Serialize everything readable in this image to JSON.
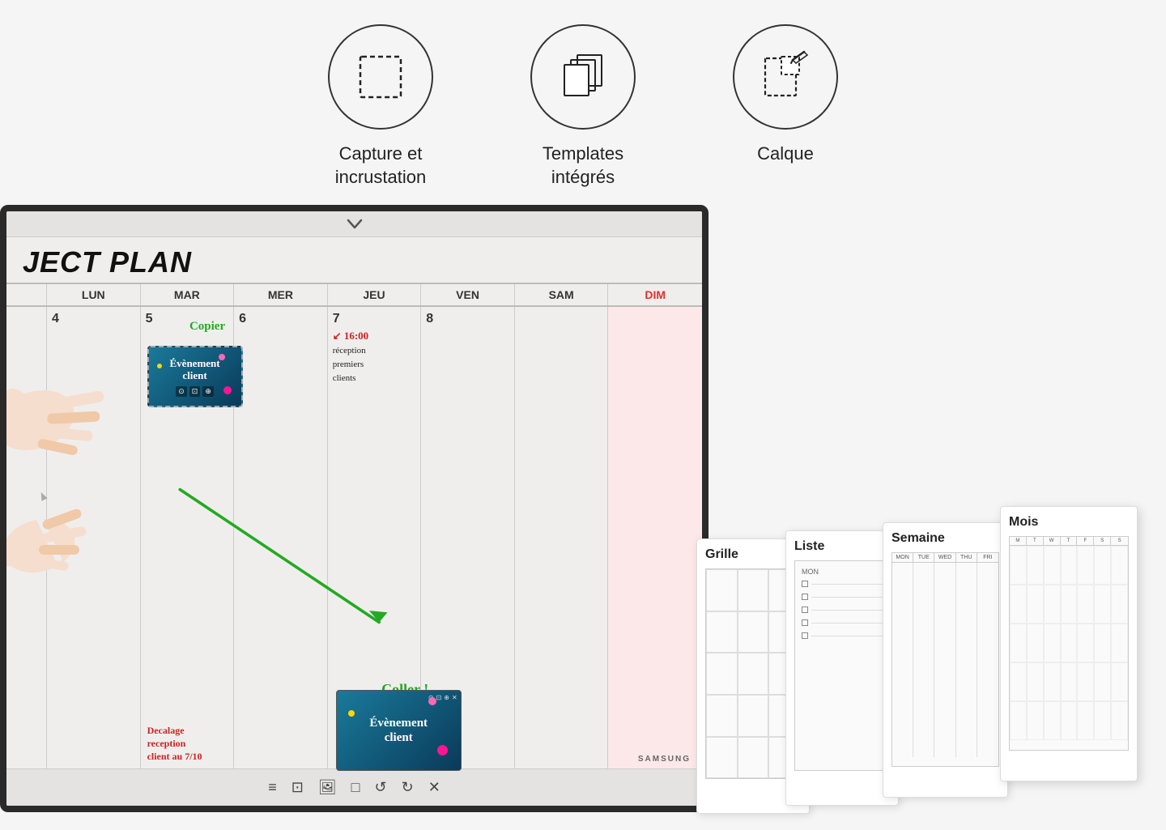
{
  "page": {
    "background": "#f5f5f5"
  },
  "top_icons": {
    "items": [
      {
        "id": "capture",
        "label": "Capture et\nincrustation",
        "label_line1": "Capture et",
        "label_line2": "incrustation",
        "icon_type": "capture"
      },
      {
        "id": "templates",
        "label": "Templates\nintégrés",
        "label_line1": "Templates",
        "label_line2": "intégrés",
        "icon_type": "layers"
      },
      {
        "id": "calque",
        "label": "Calque",
        "label_line1": "Calque",
        "label_line2": "",
        "icon_type": "layer"
      }
    ]
  },
  "calendar": {
    "title": "JECT PLAN",
    "headers": [
      "",
      "MAR",
      "MER",
      "JEU",
      "VEN",
      "SAM",
      "DIM"
    ],
    "days": [
      "4",
      "5",
      "6",
      "7",
      "8"
    ],
    "event_card": {
      "title_line1": "Évènement",
      "title_line2": "client"
    },
    "event_card2": {
      "title_line1": "Évènement",
      "title_line2": "client"
    },
    "annotations": {
      "copier": "Copier",
      "coller": "Coller !",
      "time": "↙ 16:00",
      "time2": "réception",
      "time3": "premiers",
      "time4": "clients",
      "decalage_line1": "Decalage",
      "decalage_line2": "reception",
      "decalage_line3": "client au 7/10"
    }
  },
  "toolbar": {
    "items": [
      "≡",
      "⊡",
      "⬚",
      "□",
      "↺",
      "↻",
      "×"
    ]
  },
  "template_cards": {
    "items": [
      {
        "label": "Grille",
        "type": "grille"
      },
      {
        "label": "Liste",
        "type": "liste"
      },
      {
        "label": "Semaine",
        "type": "semaine"
      },
      {
        "label": "Mois",
        "type": "mois"
      }
    ]
  },
  "brand": {
    "name": "SAMSUNG"
  }
}
